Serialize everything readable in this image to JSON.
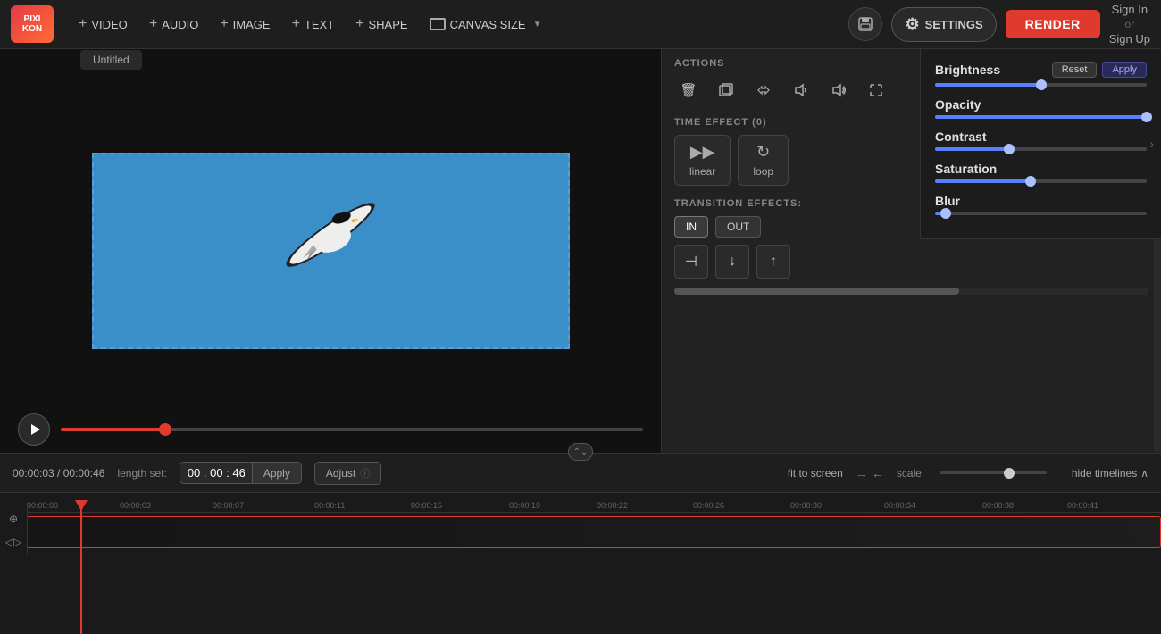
{
  "app": {
    "logo_line1": "PIXI",
    "logo_line2": "KON",
    "title": "Untitled"
  },
  "nav": {
    "video": "VIDEO",
    "audio": "AUDIO",
    "image": "IMAGE",
    "text": "TEXT",
    "shape": "SHAPE",
    "canvas_size": "CANVAS SIZE",
    "settings": "SETTINGS",
    "render": "RENDER",
    "sign_in": "Sign In",
    "or": "or",
    "sign_up": "Sign Up"
  },
  "actions": {
    "label": "ACTIONS"
  },
  "time_effect": {
    "label": "TIME EFFECT (0)",
    "linear": "linear",
    "loop": "loop"
  },
  "transition": {
    "label": "TRANSITION EFFECTS:",
    "in_btn": "IN",
    "out_btn": "OUT"
  },
  "effects": {
    "brightness": {
      "name": "Brightness",
      "reset": "Reset",
      "apply": "Apply",
      "value": 50
    },
    "opacity": {
      "name": "Opacity",
      "value": 100
    },
    "contrast": {
      "name": "Contrast",
      "value": 35
    },
    "saturation": {
      "name": "Saturation",
      "value": 45
    },
    "blur": {
      "name": "Blur",
      "value": 5
    }
  },
  "timeline": {
    "current_time": "00:00:03 / 00:00:46",
    "length_set": "length set:",
    "time_value": "00 : 00 : 46",
    "apply": "Apply",
    "adjust": "Adjust",
    "fit_to_screen": "fit to screen",
    "scale": "scale",
    "hide_timelines": "hide timelines",
    "ruler_marks": [
      "00:00:00",
      "00:00:03",
      "00:00:07",
      "00:00:11",
      "00:00:15",
      "00:00:19",
      "00:00:22",
      "00:00:26",
      "00:00:30",
      "00:00:34",
      "00:00:38",
      "00:00:41"
    ]
  }
}
